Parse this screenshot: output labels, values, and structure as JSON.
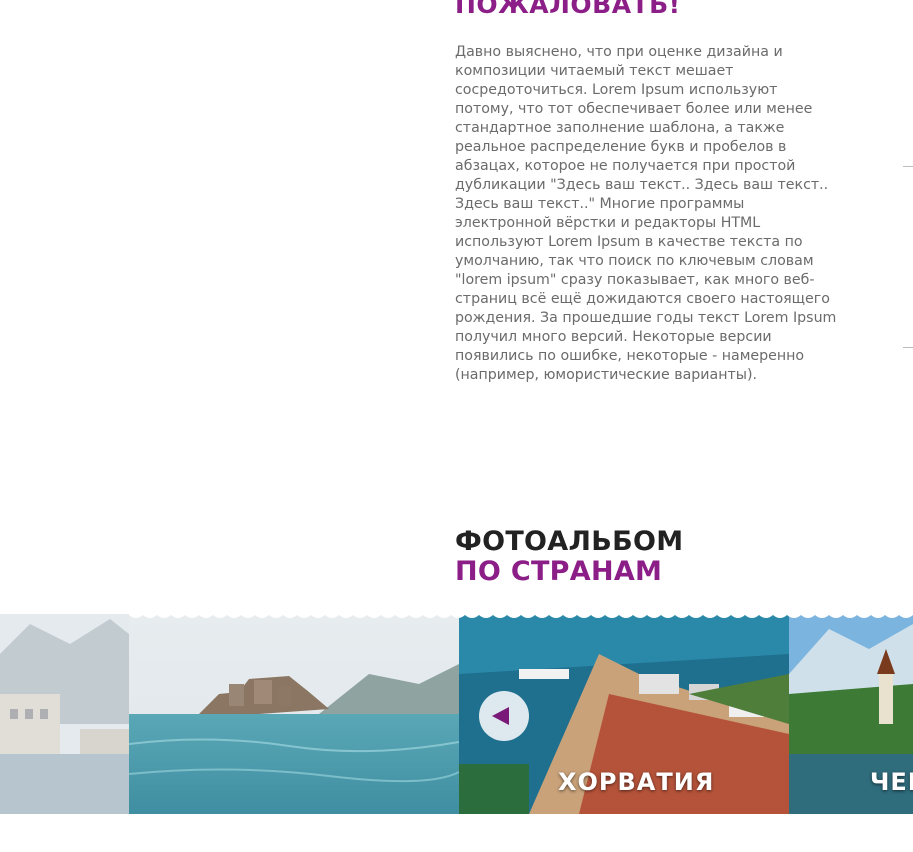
{
  "welcome": {
    "title": "ПОЖАЛОВАТЬ!",
    "text": "Давно выяснено, что при оценке дизайна и композиции читаемый текст мешает сосредоточиться. Lorem Ipsum используют потому, что тот обеспечивает более или менее стандартное заполнение шаблона, а также реальное распределение букв и пробелов в абзацах, которое не получается при простой дубликации \"Здесь ваш текст.. Здесь ваш текст.. Здесь ваш текст..\" Многие программы электронной вёрстки и редакторы HTML используют Lorem Ipsum в качестве текста по умолчанию, так что поиск по ключевым словам \"lorem ipsum\" сразу показывает, как много веб-страниц всё ещё дожидаются своего настоящего рождения. За прошедшие годы текст Lorem Ipsum получил много версий. Некоторые версии появились по ошибке, некоторые - намеренно (например, юмористические варианты)."
  },
  "album": {
    "heading_line1": "ФОТОАЛЬБОМ",
    "heading_line2": "ПО СТРАНАМ"
  },
  "gallery": {
    "slides": [
      {
        "caption": "",
        "icon": "town-photo"
      },
      {
        "caption": "",
        "icon": "island-photo"
      },
      {
        "caption": "ХОРВАТИЯ",
        "icon": "harbor-photo"
      },
      {
        "caption": "ЧЕР",
        "icon": "lake-church-photo"
      }
    ],
    "prev_icon": "arrow-left-icon"
  },
  "colors": {
    "accent": "#8b1e87",
    "heading_dark": "#222222",
    "body_text": "#6b6b6b"
  }
}
